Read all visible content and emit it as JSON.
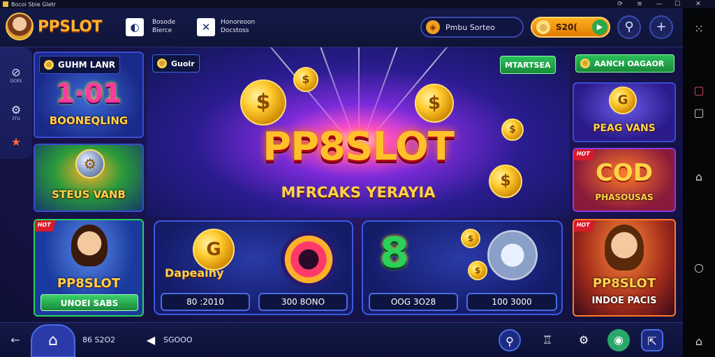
{
  "window": {
    "title": "Bocoi Sbie Gletr",
    "controls": [
      "⟳",
      "≡",
      "—",
      "☐",
      "✕"
    ]
  },
  "header": {
    "brand": "PPSLOT",
    "link1": {
      "line1": "Bosode",
      "line2": "Bierce"
    },
    "link2": {
      "line1": "Honoreoon",
      "line2": "Docstoss"
    },
    "search_label": "Pmbu Sorteo",
    "balance": "S20(",
    "add_icon": "+",
    "share_icon": "share-icon"
  },
  "left_sidebar": {
    "items": [
      {
        "icon": "⊘",
        "label": "DCKS"
      },
      {
        "icon": "⚙",
        "label": "3TU"
      },
      {
        "icon": "★",
        "label": ""
      }
    ]
  },
  "left_cards": [
    {
      "tag": "GUHM LANR",
      "label": "BOONEQLING",
      "art": "1·01"
    },
    {
      "label": "STEUS VANB"
    },
    {
      "label": "PP8SLOT",
      "button": "UNOEI SABS",
      "hot": "HOT"
    }
  ],
  "hero": {
    "tag_left": "Guoir",
    "tag_right": "MTARTSEA",
    "title": "PP8SLOT",
    "subtitle": "MFRCAKS YERAYIA"
  },
  "game_tiles": [
    {
      "name": "Dapeaihy",
      "pill": "80 :2010"
    },
    {
      "name": "",
      "pill": "300 8ONO"
    },
    {
      "name": "",
      "pill": "OOG 3O28"
    },
    {
      "name": "",
      "pill": "100 3000"
    }
  ],
  "right_cards": [
    {
      "tag": "AANCH OAGAOR",
      "label": "PEAG VANS"
    },
    {
      "label": "PHASOUSAS",
      "art": "COD",
      "hot": "HOT"
    },
    {
      "label": "PP8SLOT",
      "sub": "INDOE PACIS",
      "hot": "HOT"
    }
  ],
  "bottom": {
    "count": "86 S2O2",
    "action_label": "SGOOO"
  },
  "colors": {
    "gold": "#ffc02a",
    "accent_blue": "#3a4cd0",
    "green": "#2aa84a",
    "hot_red": "#d81a2a"
  }
}
